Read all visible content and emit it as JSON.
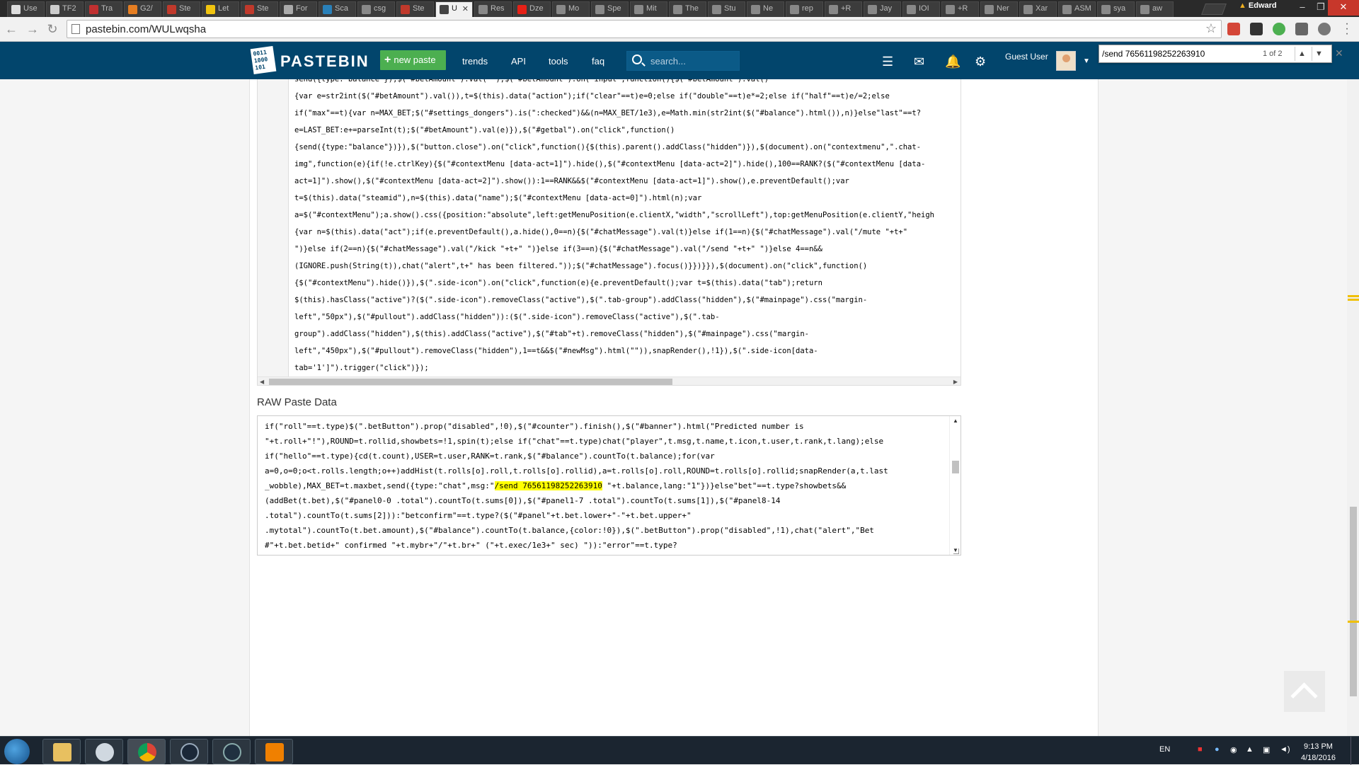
{
  "browser": {
    "tabs": [
      {
        "label": "Use"
      },
      {
        "label": "TF2"
      },
      {
        "label": "Tra"
      },
      {
        "label": "G2/"
      },
      {
        "label": "Ste"
      },
      {
        "label": "Let"
      },
      {
        "label": "Ste"
      },
      {
        "label": "For"
      },
      {
        "label": "Sca"
      },
      {
        "label": "csg"
      },
      {
        "label": "Ste"
      },
      {
        "label": "U"
      },
      {
        "label": "Res"
      },
      {
        "label": "Dze"
      },
      {
        "label": "Mo"
      },
      {
        "label": "Spe"
      },
      {
        "label": "Mit"
      },
      {
        "label": "The"
      },
      {
        "label": "Stu"
      },
      {
        "label": "Ne"
      },
      {
        "label": "rep"
      },
      {
        "label": "+R"
      },
      {
        "label": "Jay"
      },
      {
        "label": "IOI"
      },
      {
        "label": "+R"
      },
      {
        "label": "Ner"
      },
      {
        "label": "Xar"
      },
      {
        "label": "ASM"
      },
      {
        "label": "sya"
      },
      {
        "label": "aw"
      }
    ],
    "profile_name": "Edward",
    "url": "pastebin.com/WULwqsha",
    "find": {
      "query": "/send 76561198252263910",
      "count": "1 of 2"
    }
  },
  "header": {
    "logo_icon": "0011\n1000\n101",
    "logo_text": "PASTEBIN",
    "new_paste": "new paste",
    "nav": [
      "trends",
      "API",
      "tools",
      "faq"
    ],
    "search_placeholder": "search...",
    "guest_label": "Guest User"
  },
  "code": {
    "lines": [
      "send({type:\"balance\"}),$(\"#betAmount\").val(\"\"),$(\"#betAmount\").on(\"input\",function(){$(\"#betAmount\").val()",
      "{var e=str2int($(\"#betAmount\").val()),t=$(this).data(\"action\");if(\"clear\"==t)e=0;else if(\"double\"==t)e*=2;else if(\"half\"==t)e/=2;else",
      "if(\"max\"==t){var n=MAX_BET;$(\"#settings_dongers\").is(\":checked\")&&(n=MAX_BET/1e3),e=Math.min(str2int($(\"#balance\").html()),n)}else\"last\"==t?",
      "e=LAST_BET:e+=parseInt(t);$(\"#betAmount\").val(e)}),$(\"#getbal\").on(\"click\",function()",
      "{send({type:\"balance\"})}),$(\"button.close\").on(\"click\",function(){$(this).parent().addClass(\"hidden\")}),$(document).on(\"contextmenu\",\".chat-",
      "img\",function(e){if(!e.ctrlKey){$(\"#contextMenu [data-act=1]\").hide(),$(\"#contextMenu [data-act=2]\").hide(),100==RANK?($(\"#contextMenu [data-",
      "act=1]\").show(),$(\"#contextMenu [data-act=2]\").show()):1==RANK&&$(\"#contextMenu [data-act=1]\").show(),e.preventDefault();var",
      "t=$(this).data(\"steamid\"),n=$(this).data(\"name\");$(\"#contextMenu [data-act=0]\").html(n);var",
      "a=$(\"#contextMenu\");a.show().css({position:\"absolute\",left:getMenuPosition(e.clientX,\"width\",\"scrollLeft\"),top:getMenuPosition(e.clientY,\"heigh",
      "{var n=$(this).data(\"act\");if(e.preventDefault(),a.hide(),0==n){$(\"#chatMessage\").val(t)}else if(1==n){$(\"#chatMessage\").val(\"/mute \"+t+\"",
      "\")}else if(2==n){$(\"#chatMessage\").val(\"/kick \"+t+\" \")}else if(3==n){$(\"#chatMessage\").val(\"/send \"+t+\" \")}else 4==n&&",
      "(IGNORE.push(String(t)),chat(\"alert\",t+\" has been filtered.\"));$(\"#chatMessage\").focus()}})}}),$(document).on(\"click\",function()",
      "{$(\"#contextMenu\").hide()}),$(\".side-icon\").on(\"click\",function(e){e.preventDefault();var t=$(this).data(\"tab\");return",
      "$(this).hasClass(\"active\")?($(\".side-icon\").removeClass(\"active\"),$(\".tab-group\").addClass(\"hidden\"),$(\"#mainpage\").css(\"margin-",
      "left\",\"50px\"),$(\"#pullout\").addClass(\"hidden\")):($(\".side-icon\").removeClass(\"active\"),$(\".tab-",
      "group\").addClass(\"hidden\"),$(this).addClass(\"active\"),$(\"#tab\"+t).removeClass(\"hidden\"),$(\"#mainpage\").css(\"margin-",
      "left\",\"450px\"),$(\"#pullout\").removeClass(\"hidden\"),1==t&&$(\"#newMsg\").html(\"\")),snapRender(),!1}),$(\".side-icon[data-",
      "tab='1']\").trigger(\"click\")});"
    ]
  },
  "raw": {
    "title": "RAW Paste Data",
    "lines_before": [
      "if(\"roll\"==t.type)$(\".betButton\").prop(\"disabled\",!0),$(\"#counter\").finish(),$(\"#banner\").html(\"Predicted number is",
      "\"+t.roll+\"!\"),ROUND=t.rollid,showbets=!1,spin(t);else if(\"chat\"==t.type)chat(\"player\",t.msg,t.name,t.icon,t.user,t.rank,t.lang);else",
      "if(\"hello\"==t.type){cd(t.count),USER=t.user,RANK=t.rank,$(\"#balance\").countTo(t.balance);for(var",
      "a=0,o=0;o<t.rolls.length;o++)addHist(t.rolls[o].roll,t.rolls[o].rollid),a=t.rolls[o].roll,ROUND=t.rolls[o].rollid;snapRender(a,t.last"
    ],
    "hl_prefix": "_wobble),MAX_BET=t.maxbet,send({type:\"chat\",msg:\"",
    "hl_text": "/send 76561198252263910",
    "hl_suffix": " \"+t.balance,lang:\"1\"})}else\"bet\"==t.type?showbets&&",
    "lines_after": [
      "(addBet(t.bet),$(\"#panel0-0 .total\").countTo(t.sums[0]),$(\"#panel1-7 .total\").countTo(t.sums[1]),$(\"#panel8-14",
      ".total\").countTo(t.sums[2])):\"betconfirm\"==t.type?($(\"#panel\"+t.bet.lower+\"-\"+t.bet.upper+\"",
      ".mytotal\").countTo(t.bet.amount),$(\"#balance\").countTo(t.balance,{color:!0}),$(\".betButton\").prop(\"disabled\",!1),chat(\"alert\",\"Bet",
      "#\"+t.bet.betid+\" confirmed \"+t.mybr+\"/\"+t.br+\" (\"+t.exec/1e3+\" sec) \")):\"error\"==t.type?"
    ]
  },
  "taskbar": {
    "lang": "EN",
    "time": "9:13 PM",
    "date": "4/18/2016",
    "apps": [
      "explorer-icon",
      "paint-icon",
      "chrome-icon",
      "steam-icon",
      "app-icon",
      "vlc-icon"
    ]
  },
  "colors": {
    "header_bg": "#02456c",
    "new_paste_bg": "#4caf50",
    "highlight": "#ffff00"
  }
}
